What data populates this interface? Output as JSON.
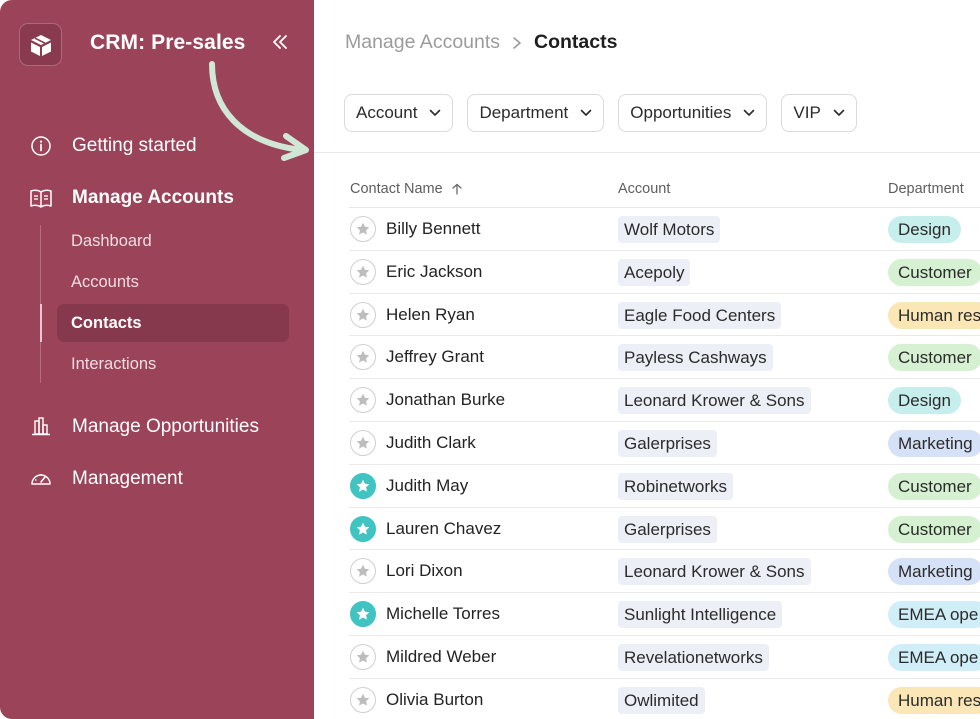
{
  "app": {
    "title": "CRM: Pre-sales"
  },
  "sidebar": {
    "nav": [
      {
        "label": "Getting started",
        "icon": "info-icon"
      },
      {
        "label": "Manage Accounts",
        "icon": "book-icon"
      },
      {
        "label": "Manage Opportunities",
        "icon": "bar-chart-icon"
      },
      {
        "label": "Management",
        "icon": "gauge-icon"
      }
    ],
    "sub": [
      {
        "label": "Dashboard",
        "active": false
      },
      {
        "label": "Accounts",
        "active": false
      },
      {
        "label": "Contacts",
        "active": true
      },
      {
        "label": "Interactions",
        "active": false
      }
    ]
  },
  "breadcrumb": {
    "parent": "Manage Accounts",
    "current": "Contacts"
  },
  "filters": [
    {
      "label": "Account"
    },
    {
      "label": "Department"
    },
    {
      "label": "Opportunities"
    },
    {
      "label": "VIP"
    }
  ],
  "table": {
    "columns": [
      "Contact Name",
      "Account",
      "Department"
    ],
    "rows": [
      {
        "name": "Billy Bennett",
        "account": "Wolf Motors",
        "department": "Design",
        "starred": false
      },
      {
        "name": "Eric Jackson",
        "account": "Acepoly",
        "department": "Customer",
        "starred": false
      },
      {
        "name": "Helen Ryan",
        "account": "Eagle Food Centers",
        "department": "Human res",
        "starred": false
      },
      {
        "name": "Jeffrey Grant",
        "account": "Payless Cashways",
        "department": "Customer",
        "starred": false
      },
      {
        "name": "Jonathan Burke",
        "account": "Leonard Krower & Sons",
        "department": "Design",
        "starred": false
      },
      {
        "name": "Judith Clark",
        "account": "Galerprises",
        "department": "Marketing",
        "starred": false
      },
      {
        "name": "Judith May",
        "account": "Robinetworks",
        "department": "Customer",
        "starred": true
      },
      {
        "name": "Lauren Chavez",
        "account": "Galerprises",
        "department": "Customer",
        "starred": true
      },
      {
        "name": "Lori Dixon",
        "account": "Leonard Krower & Sons",
        "department": "Marketing",
        "starred": false
      },
      {
        "name": "Michelle Torres",
        "account": "Sunlight Intelligence",
        "department": "EMEA ope",
        "starred": true
      },
      {
        "name": "Mildred Weber",
        "account": "Revelationetworks",
        "department": "EMEA ope",
        "starred": false
      },
      {
        "name": "Olivia Burton",
        "account": "Owlimited",
        "department": "Human res",
        "starred": false
      }
    ]
  },
  "colors": {
    "sidebar_bg": "#9b4459",
    "star_active": "#3fc4c2",
    "annotation_arrow": "#cfe7d4"
  }
}
